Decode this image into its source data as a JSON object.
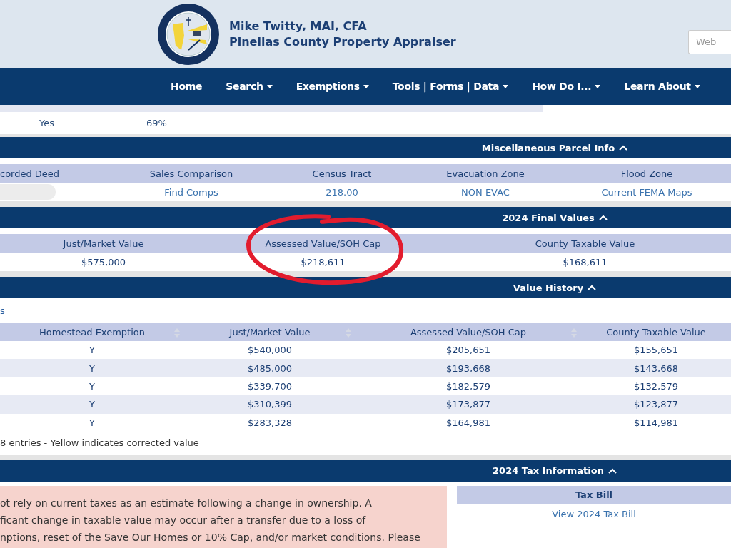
{
  "header": {
    "name_line": "Mike Twitty, MAI, CFA",
    "office_line": "Pinellas County Property Appraiser",
    "search": {
      "placeholder": "Web"
    }
  },
  "nav": [
    {
      "label": "Home",
      "dropdown": false
    },
    {
      "label": "Search",
      "dropdown": true
    },
    {
      "label": "Exemptions",
      "dropdown": true
    },
    {
      "label": "Tools | Forms | Data",
      "dropdown": true
    },
    {
      "label": "How Do I...",
      "dropdown": true
    },
    {
      "label": "Learn About",
      "dropdown": true
    }
  ],
  "exemption_row": {
    "answer": "Yes",
    "percent": "69%"
  },
  "misc": {
    "title": "Miscellaneous Parcel Info",
    "expanded": true,
    "columns": [
      "corded Deed",
      "Sales Comparison",
      "Census Tract",
      "Evacuation Zone",
      "Flood Zone"
    ],
    "values": [
      {
        "kind": "redacted"
      },
      {
        "kind": "link",
        "text": "Find Comps"
      },
      {
        "kind": "link",
        "text": "218.00"
      },
      {
        "kind": "link",
        "text": "NON EVAC"
      },
      {
        "kind": "link",
        "text": "Current FEMA Maps"
      }
    ]
  },
  "final_values": {
    "title": "2024 Final Values",
    "expanded": true,
    "columns": [
      "Just/Market Value",
      "Assessed Value/SOH Cap",
      "County Taxable Value"
    ],
    "values": [
      "$575,000",
      "$218,611",
      "$168,611"
    ]
  },
  "value_history": {
    "title": "Value History",
    "expanded": true,
    "caption": "s",
    "columns": [
      {
        "label": "Homestead Exemption",
        "sortable": true
      },
      {
        "label": "Just/Market Value",
        "sortable": true
      },
      {
        "label": "Assessed Value/SOH Cap",
        "sortable": true
      },
      {
        "label": "County Taxable Value",
        "sortable": false
      }
    ],
    "rows": [
      [
        "Y",
        "$540,000",
        "$205,651",
        "$155,651"
      ],
      [
        "Y",
        "$485,000",
        "$193,668",
        "$143,668"
      ],
      [
        "Y",
        "$339,700",
        "$182,579",
        "$132,579"
      ],
      [
        "Y",
        "$310,399",
        "$173,877",
        "$123,877"
      ],
      [
        "Y",
        "$283,328",
        "$164,981",
        "$114,981"
      ]
    ],
    "footer": "8 entries  -  Yellow indicates corrected value"
  },
  "tax": {
    "title": "2024 Tax Information",
    "expanded": true,
    "notice_lines": [
      "ot rely on current taxes as an estimate following a change in ownership. A",
      "ficant change in taxable value may occur after a transfer due to a loss of",
      "nptions, reset of the Save Our Homes or 10% Cap, and/or market conditions. Please"
    ],
    "bill": {
      "heading": "Tax Bill",
      "link": "View 2024 Tax Bill"
    }
  }
}
